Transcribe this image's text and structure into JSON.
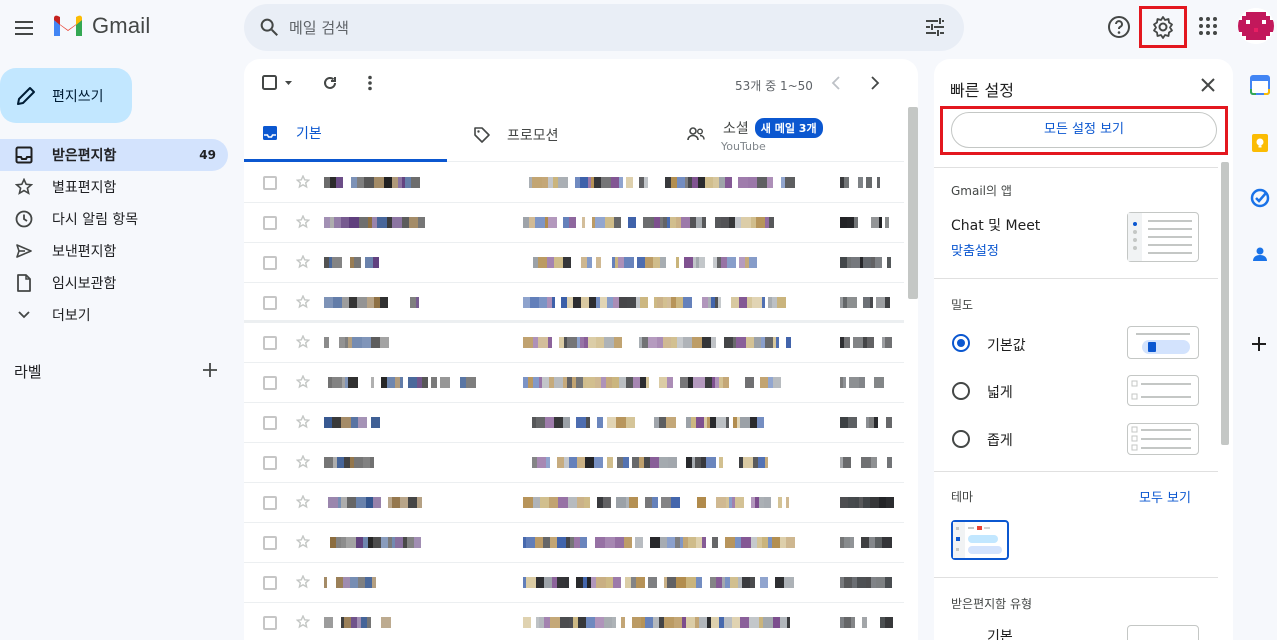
{
  "app": {
    "name": "Gmail"
  },
  "search": {
    "placeholder": "메일 검색"
  },
  "compose": {
    "label": "편지쓰기"
  },
  "nav": [
    {
      "label": "받은편지함",
      "count": "49",
      "icon": "inbox-icon",
      "active": true
    },
    {
      "label": "별표편지함",
      "icon": "star-icon"
    },
    {
      "label": "다시 알림 항목",
      "icon": "clock-icon"
    },
    {
      "label": "보낸편지함",
      "icon": "send-icon"
    },
    {
      "label": "임시보관함",
      "icon": "draft-icon"
    },
    {
      "label": "더보기",
      "icon": "chevron-down-icon"
    }
  ],
  "labels_heading": "라벨",
  "toolbar": {
    "pager": "53개 중 1~50"
  },
  "tabs": [
    {
      "label": "기본",
      "active": true
    },
    {
      "label": "프로모션"
    },
    {
      "label": "소셜",
      "badge": "새 메일 3개",
      "sub": "YouTube"
    }
  ],
  "email_row_count": 12,
  "quick_settings": {
    "title": "빠른 설정",
    "see_all": "모든 설정 보기",
    "apps_heading": "Gmail의 앱",
    "apps_item": "Chat 및 Meet",
    "apps_link": "맞춤설정",
    "density_heading": "밀도",
    "density_options": [
      {
        "label": "기본값",
        "selected": true
      },
      {
        "label": "넓게",
        "selected": false
      },
      {
        "label": "좁게",
        "selected": false
      }
    ],
    "theme_heading": "테마",
    "theme_link": "모두 보기",
    "inbox_type_heading": "받은편지함 유형",
    "inbox_type_first": "기본"
  },
  "colors": {
    "accent": "#0b57d0",
    "highlight_box": "#e3171f",
    "compose_bg": "#c2e7ff",
    "active_nav_bg": "#d3e3fd"
  }
}
